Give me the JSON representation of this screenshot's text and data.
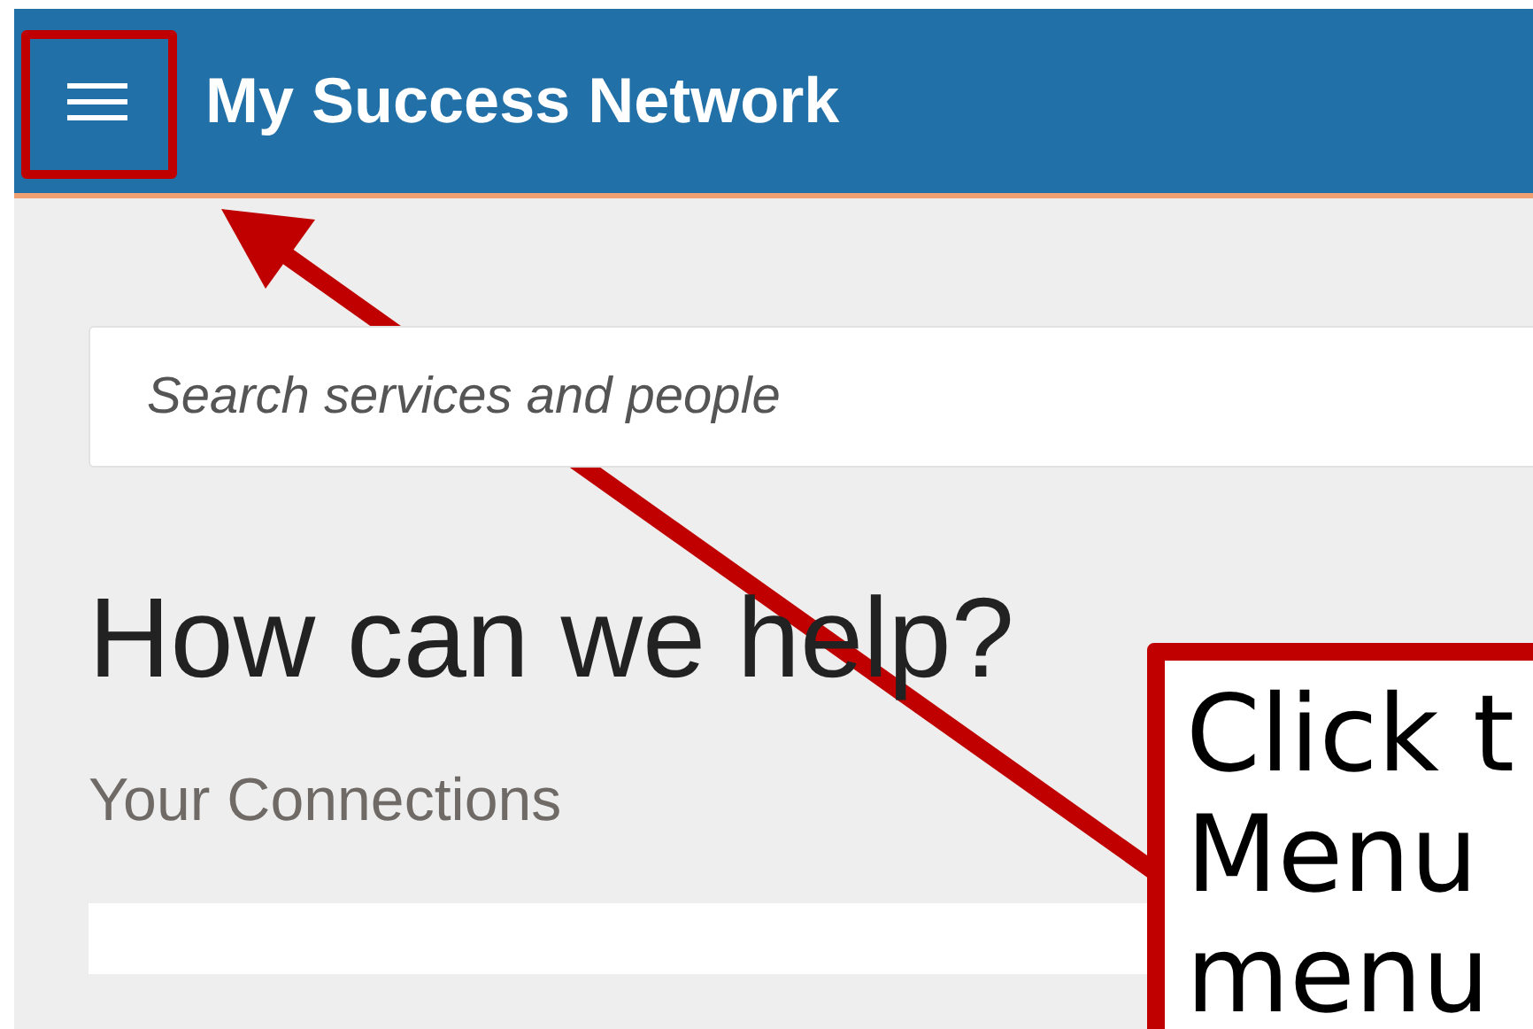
{
  "header": {
    "title": "My Success Network"
  },
  "search": {
    "placeholder": "Search services and people"
  },
  "heading": "How can we help?",
  "section_title": "Your Connections",
  "callout": {
    "lines": [
      "Click t",
      "Menu",
      "menu"
    ]
  }
}
